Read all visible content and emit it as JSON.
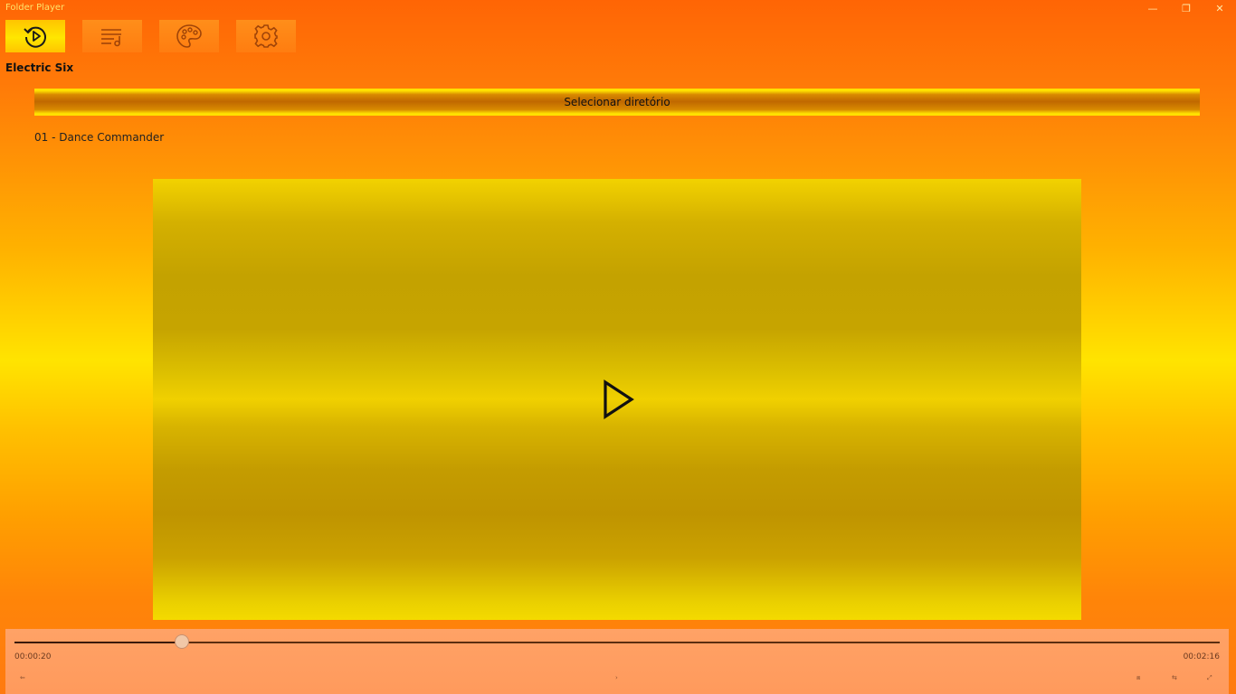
{
  "window": {
    "title": "Folder Player",
    "minimize_glyph": "—",
    "restore_glyph": "❐",
    "close_glyph": "✕"
  },
  "nav": [
    {
      "icon": "now-playing-icon",
      "active": true
    },
    {
      "icon": "playlist-icon",
      "active": false
    },
    {
      "icon": "palette-icon",
      "active": false
    },
    {
      "icon": "gear-icon",
      "active": false
    }
  ],
  "artist": "Electric Six",
  "select_directory_label": "Selecionar diretório",
  "track_title": "01 - Dance Commander",
  "player": {
    "play_icon": "play-icon",
    "position_time": "00:00:20",
    "duration_time": "00:02:16",
    "progress_fraction": 0.139
  },
  "controls": {
    "left_glyph": "⇐",
    "center_glyph": "›",
    "right1_glyph": "⧈",
    "right2_glyph": "⇆",
    "right3_glyph": "⤢"
  },
  "colors": {
    "accent": "#ffe100",
    "controls_bg": "#ffa266"
  }
}
